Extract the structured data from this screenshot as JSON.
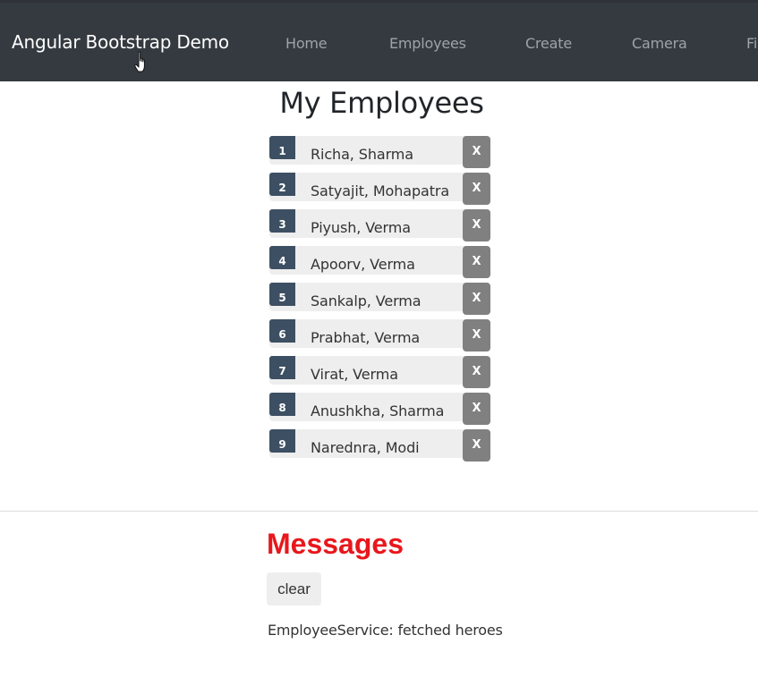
{
  "navbar": {
    "brand": "Angular Bootstrap Demo",
    "items": [
      {
        "label": "Home"
      },
      {
        "label": "Employees"
      },
      {
        "label": "Create"
      },
      {
        "label": "Camera"
      },
      {
        "label": "Fi"
      }
    ]
  },
  "main": {
    "title": "My Employees",
    "delete_label": "X",
    "employees": [
      {
        "id": "1",
        "name": "Richa, Sharma"
      },
      {
        "id": "2",
        "name": "Satyajit, Mohapatra"
      },
      {
        "id": "3",
        "name": "Piyush, Verma"
      },
      {
        "id": "4",
        "name": "Apoorv, Verma"
      },
      {
        "id": "5",
        "name": "Sankalp, Verma"
      },
      {
        "id": "6",
        "name": "Prabhat, Verma"
      },
      {
        "id": "7",
        "name": "Virat, Verma"
      },
      {
        "id": "8",
        "name": "Anushkha, Sharma"
      },
      {
        "id": "9",
        "name": "Narednra, Modi"
      }
    ]
  },
  "messages": {
    "title": "Messages",
    "clear_label": "clear",
    "items": [
      "EmployeeService: fetched heroes"
    ]
  },
  "colors": {
    "navbar_bg": "#343a40",
    "badge_bg": "#3d4f62",
    "delete_bg": "#808080",
    "messages_title": "#e8171c"
  },
  "icons": {
    "cursor": "hand-pointer-icon"
  }
}
